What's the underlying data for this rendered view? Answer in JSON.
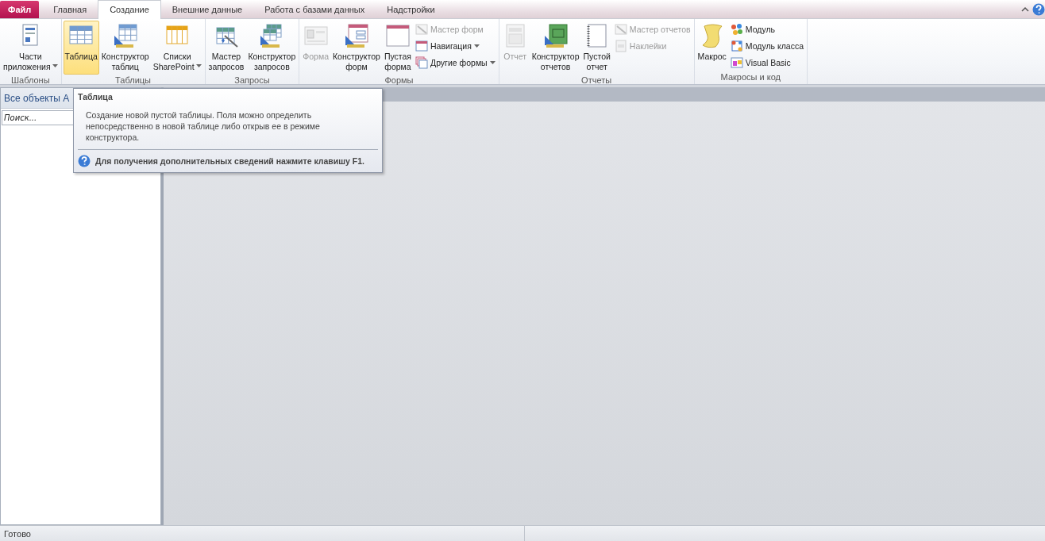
{
  "tabs": [
    {
      "label": "Файл",
      "kind": "file",
      "selected": false
    },
    {
      "label": "Главная",
      "kind": "tab",
      "selected": false
    },
    {
      "label": "Создание",
      "kind": "tab",
      "selected": true
    },
    {
      "label": "Внешние данные",
      "kind": "tab",
      "selected": false
    },
    {
      "label": "Работа с базами данных",
      "kind": "tab",
      "selected": false
    },
    {
      "label": "Надстройки",
      "kind": "tab",
      "selected": false
    }
  ],
  "ribbon_groups": [
    {
      "label": "Шаблоны",
      "items": [
        {
          "kind": "large",
          "label": "Части\nприложения",
          "dropdown": true,
          "disabled": false,
          "hovered": false
        }
      ]
    },
    {
      "label": "Таблицы",
      "items": [
        {
          "kind": "large",
          "label": "Таблица",
          "dropdown": false,
          "disabled": false,
          "hovered": true
        },
        {
          "kind": "large",
          "label": "Конструктор\nтаблиц",
          "dropdown": false,
          "disabled": false,
          "hovered": false
        },
        {
          "kind": "large",
          "label": "Списки\nSharePoint",
          "dropdown": true,
          "disabled": false,
          "hovered": false
        }
      ]
    },
    {
      "label": "Запросы",
      "items": [
        {
          "kind": "large",
          "label": "Мастер\nзапросов",
          "dropdown": false,
          "disabled": false,
          "hovered": false
        },
        {
          "kind": "large",
          "label": "Конструктор\nзапросов",
          "dropdown": false,
          "disabled": false,
          "hovered": false
        }
      ]
    },
    {
      "label": "Формы",
      "items": [
        {
          "kind": "large",
          "label": "Форма",
          "dropdown": false,
          "disabled": true,
          "hovered": false
        },
        {
          "kind": "large",
          "label": "Конструктор\nформ",
          "dropdown": false,
          "disabled": false,
          "hovered": false
        },
        {
          "kind": "large",
          "label": "Пустая\nформа",
          "dropdown": false,
          "disabled": false,
          "hovered": false
        },
        {
          "kind": "stack",
          "items": [
            {
              "label": "Мастер форм",
              "dropdown": false,
              "disabled": true
            },
            {
              "label": "Навигация",
              "dropdown": true,
              "disabled": false
            },
            {
              "label": "Другие формы",
              "dropdown": true,
              "disabled": false
            }
          ]
        }
      ]
    },
    {
      "label": "Отчеты",
      "items": [
        {
          "kind": "large",
          "label": "Отчет",
          "dropdown": false,
          "disabled": true,
          "hovered": false
        },
        {
          "kind": "large",
          "label": "Конструктор\nотчетов",
          "dropdown": false,
          "disabled": false,
          "hovered": false
        },
        {
          "kind": "large",
          "label": "Пустой\nотчет",
          "dropdown": false,
          "disabled": false,
          "hovered": false
        },
        {
          "kind": "stack",
          "items": [
            {
              "label": "Мастер отчетов",
              "dropdown": false,
              "disabled": true
            },
            {
              "label": "Наклейки",
              "dropdown": false,
              "disabled": true
            }
          ]
        }
      ]
    },
    {
      "label": "Макросы и код",
      "items": [
        {
          "kind": "large",
          "label": "Макрос",
          "dropdown": false,
          "disabled": false,
          "hovered": false
        },
        {
          "kind": "stack",
          "items": [
            {
              "label": "Модуль",
              "dropdown": false,
              "disabled": false
            },
            {
              "label": "Модуль класса",
              "dropdown": false,
              "disabled": false
            },
            {
              "label": "Visual Basic",
              "dropdown": false,
              "disabled": false
            }
          ]
        }
      ]
    }
  ],
  "navigation_pane": {
    "title": "Все объекты A",
    "search": {
      "placeholder": "Поиск..."
    }
  },
  "tooltip": {
    "title": "Таблица",
    "body": "Создание новой пустой таблицы. Поля можно определить непосредственно в новой таблице либо открыв ее в режиме конструктора.",
    "help": "Для получения дополнительных сведений нажмите клавишу F1."
  },
  "status_bar": {
    "text": "Готово"
  }
}
